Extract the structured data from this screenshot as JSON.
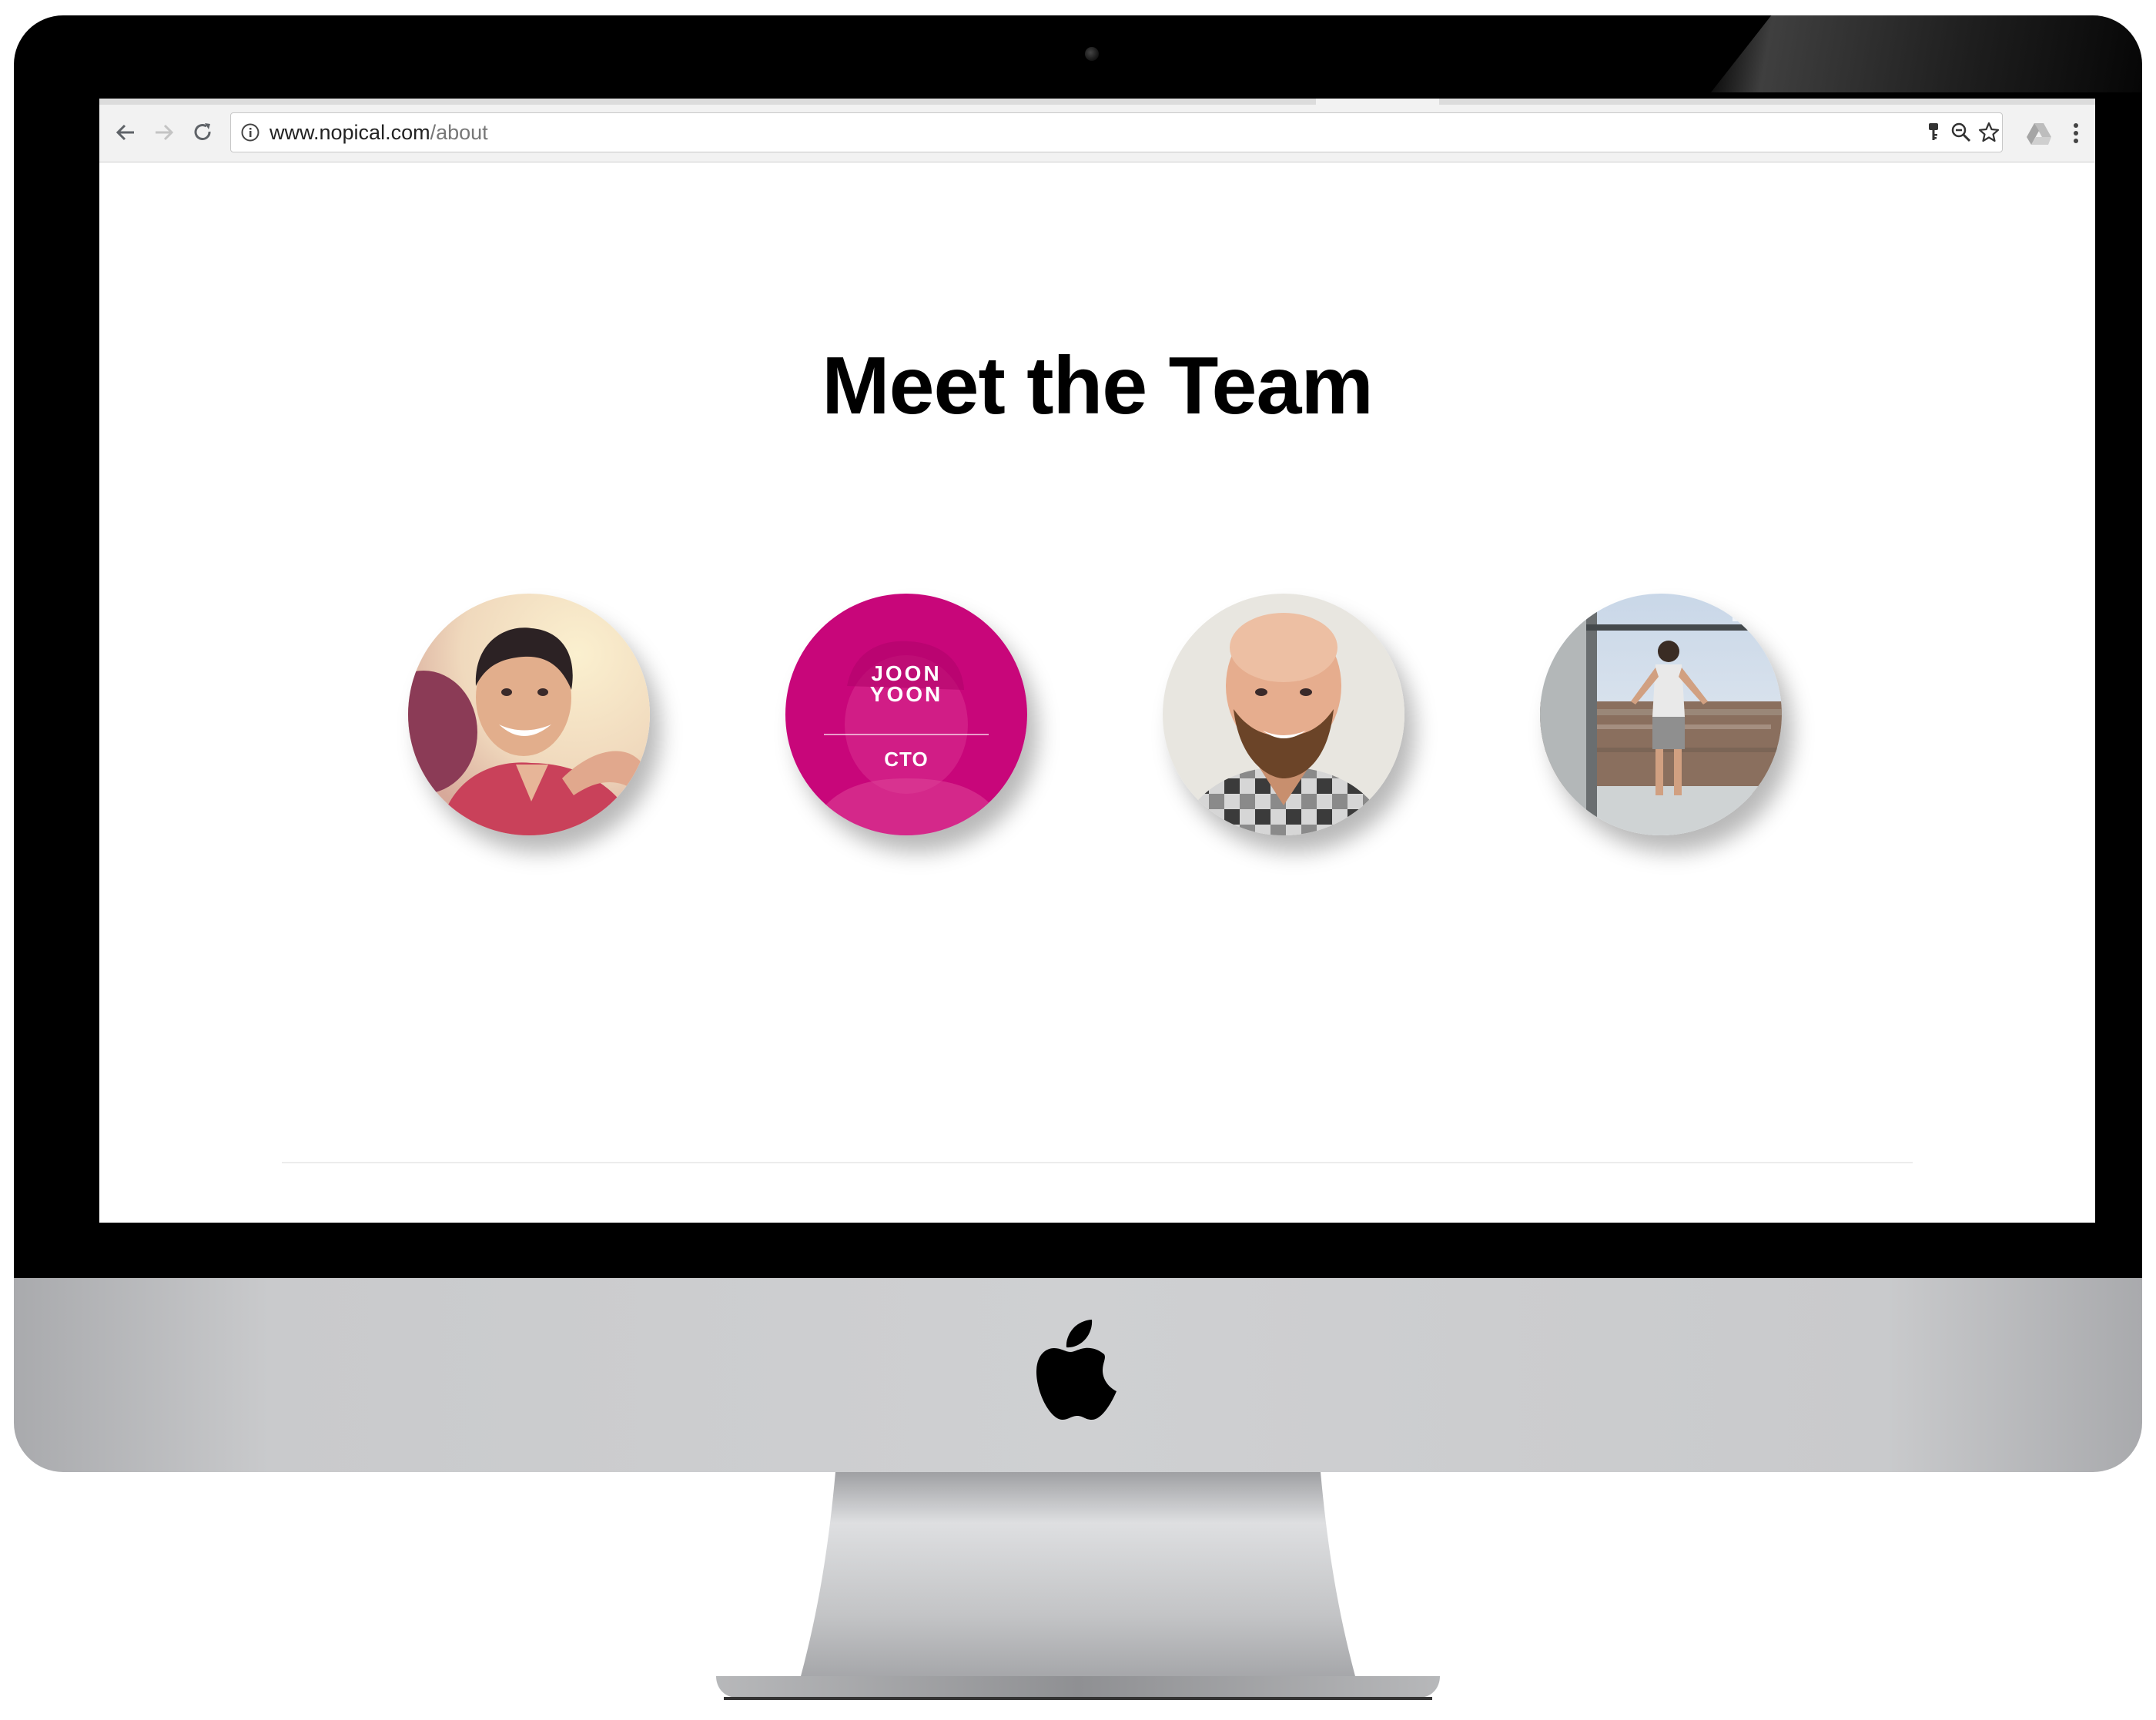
{
  "browser": {
    "url_host": "www.nopical.com",
    "url_path": "/about"
  },
  "page": {
    "title": "Meet the Team",
    "members": [
      {
        "photo": "member-photo-1"
      },
      {
        "name": "JOON\nYOON",
        "role": "CTO",
        "highlight_color": "#c8067a"
      },
      {
        "photo": "member-photo-3"
      },
      {
        "photo": "member-photo-4"
      }
    ]
  },
  "icons": {
    "back": "arrow-left-icon",
    "forward": "arrow-right-icon",
    "reload": "reload-icon",
    "site_info": "info-icon",
    "key": "key-icon",
    "zoom": "zoom-icon",
    "bookmark": "star-icon",
    "extension": "drive-icon",
    "menu": "kebab-menu-icon"
  }
}
